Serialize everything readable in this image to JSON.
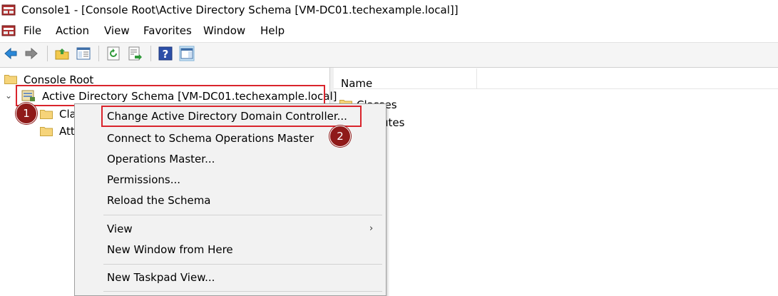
{
  "window": {
    "title": "Console1 - [Console Root\\Active Directory Schema [VM-DC01.techexample.local]]"
  },
  "menubar": {
    "items": [
      "File",
      "Action",
      "View",
      "Favorites",
      "Window",
      "Help"
    ]
  },
  "toolbar": {
    "buttons": [
      "back-arrow-icon",
      "forward-arrow-icon",
      "up-folder-icon",
      "show-hide-tree-icon",
      "refresh-icon",
      "export-list-icon",
      "help-icon",
      "show-hide-action-pane-icon"
    ]
  },
  "tree": {
    "root": "Console Root",
    "schema_node": "Active Directory Schema [VM-DC01.techexample.local]",
    "children": [
      "Cla",
      "Att"
    ]
  },
  "results": {
    "column_name": "Name",
    "rows": [
      "Classes",
      "utes"
    ]
  },
  "context_menu": {
    "items": [
      "Change Active Directory Domain Controller...",
      "Connect to Schema Operations Master",
      "Operations Master...",
      "Permissions...",
      "Reload the Schema",
      "View",
      "New Window from Here",
      "New Taskpad View..."
    ]
  },
  "badges": {
    "step1": "1",
    "step2": "2"
  },
  "colors": {
    "highlight": "#d9242c",
    "badge": "#8f1a19",
    "folder": "#f6d47a"
  }
}
